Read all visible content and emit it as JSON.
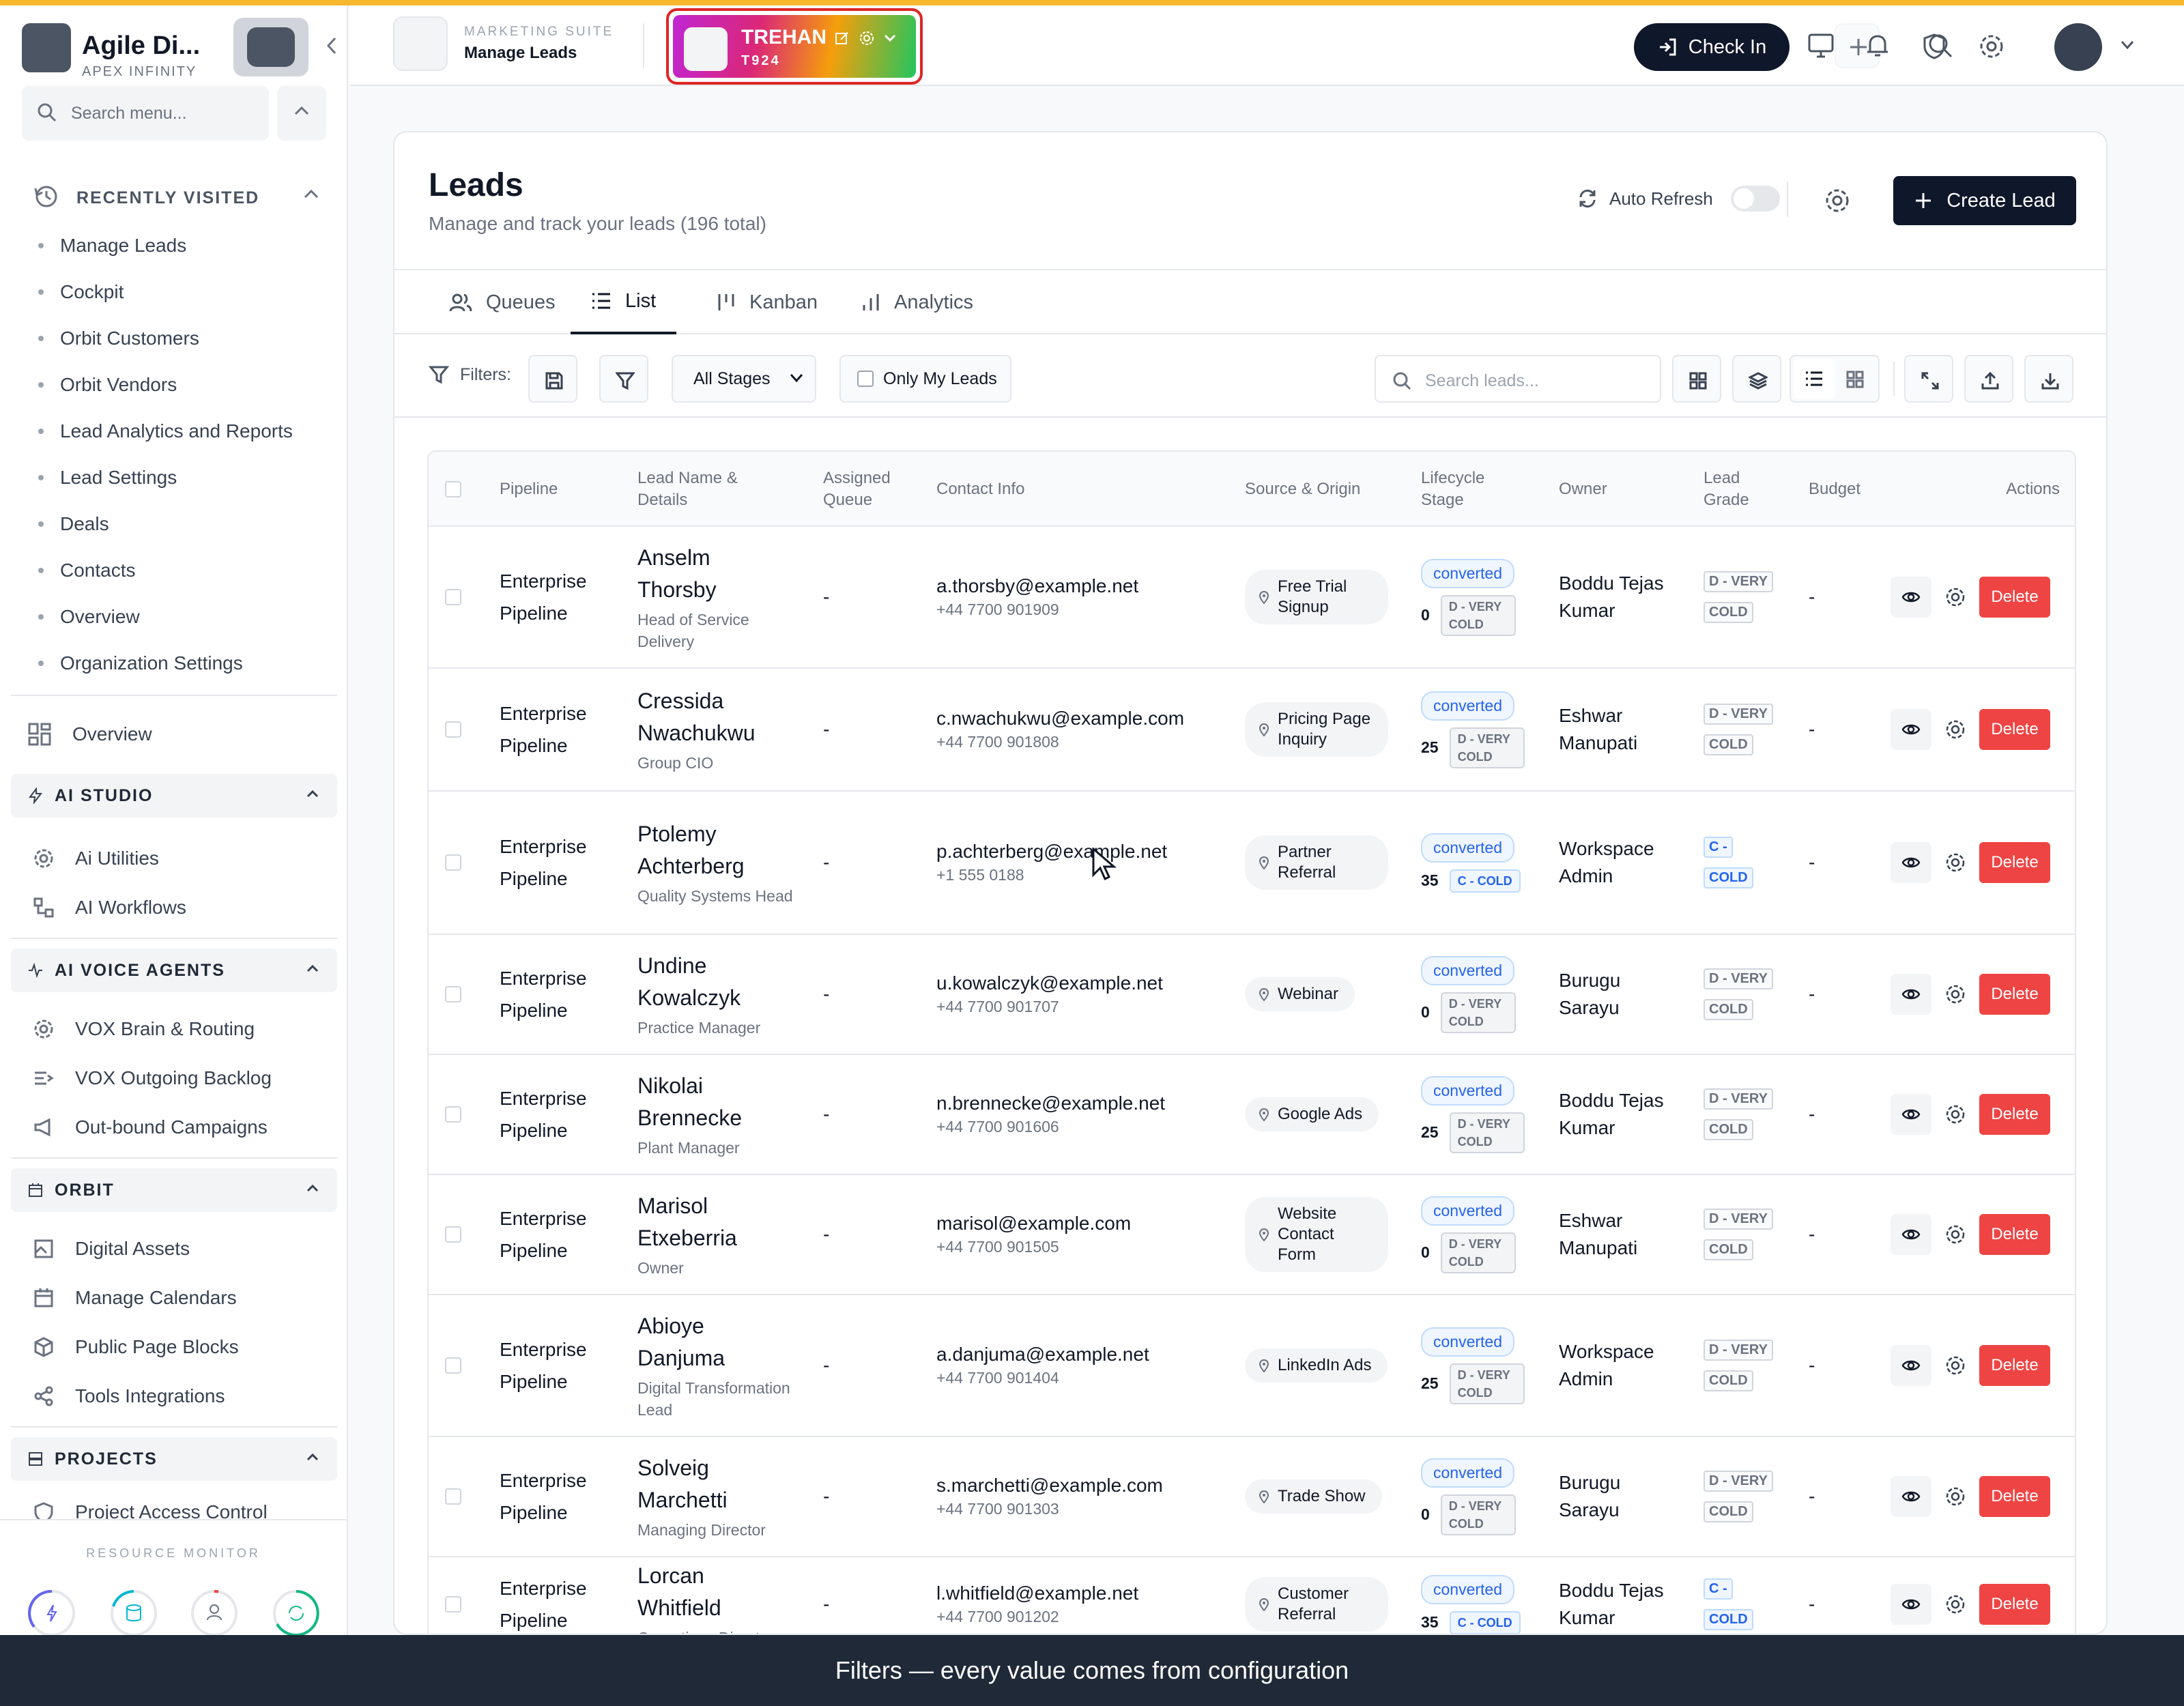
{
  "sidebar": {
    "brand_name": "Agile Di...",
    "brand_sub": "APEX INFINITY",
    "search_placeholder": "Search menu...",
    "recent_label": "RECENTLY VISITED",
    "recent_items": [
      "Manage Leads",
      "Cockpit",
      "Orbit Customers",
      "Orbit Vendors",
      "Lead Analytics and Reports",
      "Lead Settings",
      "Deals",
      "Contacts",
      "Overview",
      "Organization Settings"
    ],
    "overview_label": "Overview",
    "sections": {
      "ai_studio": {
        "label": "AI STUDIO",
        "items": [
          "Ai Utilities",
          "AI Workflows"
        ]
      },
      "ai_voice": {
        "label": "AI VOICE AGENTS",
        "items": [
          "VOX Brain & Routing",
          "VOX Outgoing Backlog",
          "Out-bound Campaigns"
        ]
      },
      "orbit": {
        "label": "ORBIT",
        "items": [
          "Digital Assets",
          "Manage Calendars",
          "Public Page Blocks",
          "Tools Integrations"
        ]
      },
      "projects": {
        "label": "PROJECTS",
        "items": [
          "Project Access Control"
        ]
      }
    },
    "resource_monitor": "RESOURCE MONITOR",
    "gauges": [
      {
        "icon": "bolt-icon",
        "color": "#6366f1"
      },
      {
        "icon": "database-icon",
        "color": "#06b6d4"
      },
      {
        "icon": "users-icon",
        "color": "#ef4444"
      },
      {
        "icon": "refresh-icon",
        "color": "#10b981"
      }
    ]
  },
  "topbar": {
    "suite": "MARKETING SUITE",
    "page": "Manage Leads",
    "workspace_name": "TREHAN",
    "workspace_code": "T924",
    "checkin_label": "Check In"
  },
  "page": {
    "title": "Leads",
    "subtitle": "Manage and track your leads (196 total)",
    "auto_refresh": "Auto Refresh",
    "create_label": "Create Lead",
    "tabs": [
      "Queues",
      "List",
      "Kanban",
      "Analytics"
    ],
    "active_tab": "List"
  },
  "filters": {
    "label": "Filters:",
    "stage_value": "All Stages",
    "only_mine": "Only My Leads",
    "search_placeholder": "Search leads..."
  },
  "table": {
    "columns": [
      {
        "key": "pipeline",
        "label": "Pipeline"
      },
      {
        "key": "lead",
        "label": "Lead Name & Details"
      },
      {
        "key": "queue",
        "label": "Assigned Queue"
      },
      {
        "key": "contact",
        "label": "Contact Info"
      },
      {
        "key": "source",
        "label": "Source & Origin"
      },
      {
        "key": "stage",
        "label": "Lifecycle Stage"
      },
      {
        "key": "owner",
        "label": "Owner"
      },
      {
        "key": "grade",
        "label": "Lead Grade"
      },
      {
        "key": "budget",
        "label": "Budget"
      },
      {
        "key": "actions",
        "label": "Actions"
      }
    ],
    "delete_label": "Delete",
    "rows": [
      {
        "pipeline": "Enterprise Pipeline",
        "first": "Anselm",
        "last": "Thorsby",
        "title": "Head of Service Delivery",
        "queue": "-",
        "email": "a.thorsby@example.net",
        "phone": "+44 7700 901909",
        "source": "Free Trial Signup",
        "stage": "converted",
        "score": "0",
        "grade_small": "D - VERY COLD",
        "owner": "Boddu Tejas Kumar",
        "grade_a": "D - VERY",
        "grade_b": "COLD",
        "budget": "-",
        "grade_type": "d"
      },
      {
        "pipeline": "Enterprise Pipeline",
        "first": "Cressida",
        "last": "Nwachukwu",
        "title": "Group CIO",
        "queue": "-",
        "email": "c.nwachukwu@example.com",
        "phone": "+44 7700 901808",
        "source": "Pricing Page Inquiry",
        "stage": "converted",
        "score": "25",
        "grade_small": "D - VERY COLD",
        "owner": "Eshwar Manupati",
        "grade_a": "D - VERY",
        "grade_b": "COLD",
        "budget": "-",
        "grade_type": "d"
      },
      {
        "pipeline": "Enterprise Pipeline",
        "first": "Ptolemy",
        "last": "Achterberg",
        "title": "Quality Systems Head",
        "queue": "-",
        "email": "p.achterberg@example.net",
        "phone": "+1 555 0188",
        "source": "Partner Referral",
        "stage": "converted",
        "score": "35",
        "grade_small": "C - COLD",
        "owner": "Workspace Admin",
        "grade_a": "C -",
        "grade_b": "COLD",
        "budget": "-",
        "grade_type": "c"
      },
      {
        "pipeline": "Enterprise Pipeline",
        "first": "Undine",
        "last": "Kowalczyk",
        "title": "Practice Manager",
        "queue": "-",
        "email": "u.kowalczyk@example.net",
        "phone": "+44 7700 901707",
        "source": "Webinar",
        "stage": "converted",
        "score": "0",
        "grade_small": "D - VERY COLD",
        "owner": "Burugu Sarayu",
        "grade_a": "D - VERY",
        "grade_b": "COLD",
        "budget": "-",
        "grade_type": "d"
      },
      {
        "pipeline": "Enterprise Pipeline",
        "first": "Nikolai",
        "last": "Brennecke",
        "title": "Plant Manager",
        "queue": "-",
        "email": "n.brennecke@example.net",
        "phone": "+44 7700 901606",
        "source": "Google Ads",
        "stage": "converted",
        "score": "25",
        "grade_small": "D - VERY COLD",
        "owner": "Boddu Tejas Kumar",
        "grade_a": "D - VERY",
        "grade_b": "COLD",
        "budget": "-",
        "grade_type": "d"
      },
      {
        "pipeline": "Enterprise Pipeline",
        "first": "Marisol",
        "last": "Etxeberria",
        "title": "Owner",
        "queue": "-",
        "email": "marisol@example.com",
        "phone": "+44 7700 901505",
        "source": "Website Contact Form",
        "stage": "converted",
        "score": "0",
        "grade_small": "D - VERY COLD",
        "owner": "Eshwar Manupati",
        "grade_a": "D - VERY",
        "grade_b": "COLD",
        "budget": "-",
        "grade_type": "d"
      },
      {
        "pipeline": "Enterprise Pipeline",
        "first": "Abioye",
        "last": "Danjuma",
        "title": "Digital Transformation Lead",
        "queue": "-",
        "email": "a.danjuma@example.net",
        "phone": "+44 7700 901404",
        "source": "LinkedIn Ads",
        "stage": "converted",
        "score": "25",
        "grade_small": "D - VERY COLD",
        "owner": "Workspace Admin",
        "grade_a": "D - VERY",
        "grade_b": "COLD",
        "budget": "-",
        "grade_type": "d"
      },
      {
        "pipeline": "Enterprise Pipeline",
        "first": "Solveig",
        "last": "Marchetti",
        "title": "Managing Director",
        "queue": "-",
        "email": "s.marchetti@example.com",
        "phone": "+44 7700 901303",
        "source": "Trade Show",
        "stage": "converted",
        "score": "0",
        "grade_small": "D - VERY COLD",
        "owner": "Burugu Sarayu",
        "grade_a": "D - VERY",
        "grade_b": "COLD",
        "budget": "-",
        "grade_type": "d"
      },
      {
        "pipeline": "Enterprise Pipeline",
        "first": "Lorcan",
        "last": "Whitfield",
        "title": "Operations Director",
        "queue": "-",
        "email": "l.whitfield@example.net",
        "phone": "+44 7700 901202",
        "source": "Customer Referral",
        "stage": "converted",
        "score": "35",
        "grade_small": "C - COLD",
        "owner": "Boddu Tejas Kumar",
        "grade_a": "C -",
        "grade_b": "COLD",
        "budget": "-",
        "grade_type": "c"
      }
    ]
  },
  "toast": "Filters — every value comes from configuration"
}
